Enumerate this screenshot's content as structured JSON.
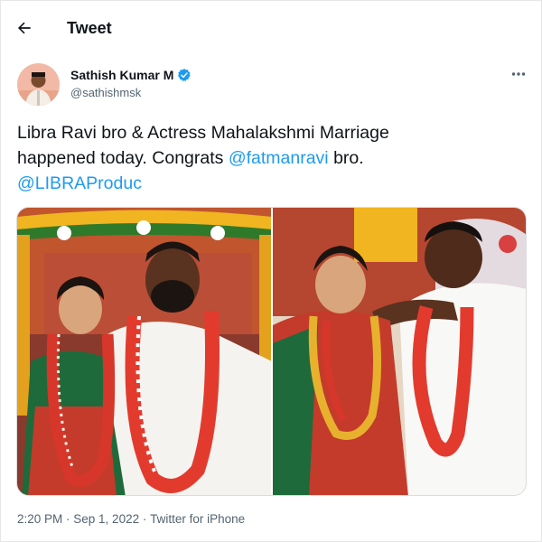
{
  "header": {
    "title": "Tweet",
    "back_icon": "arrow-left-icon"
  },
  "author": {
    "name": "Sathish Kumar M",
    "handle": "@sathishmsk",
    "verified": true,
    "verified_icon": "verified-badge-icon",
    "verified_color": "#1d9bf0"
  },
  "tweet": {
    "line1": "Libra Ravi bro & Actress Mahalakshmi Marriage",
    "line2_prefix": "happened today. Congrats ",
    "mention1": "@fatmanravi",
    "line2_suffix": " bro.",
    "mention2": "@LIBRAProduc",
    "mention_color": "#1d9bf0"
  },
  "meta": {
    "time": "2:20 PM",
    "separator": " · ",
    "date": "Sep 1, 2022",
    "client": "Twitter for iPhone"
  },
  "more_icon": "more-horizontal-icon"
}
